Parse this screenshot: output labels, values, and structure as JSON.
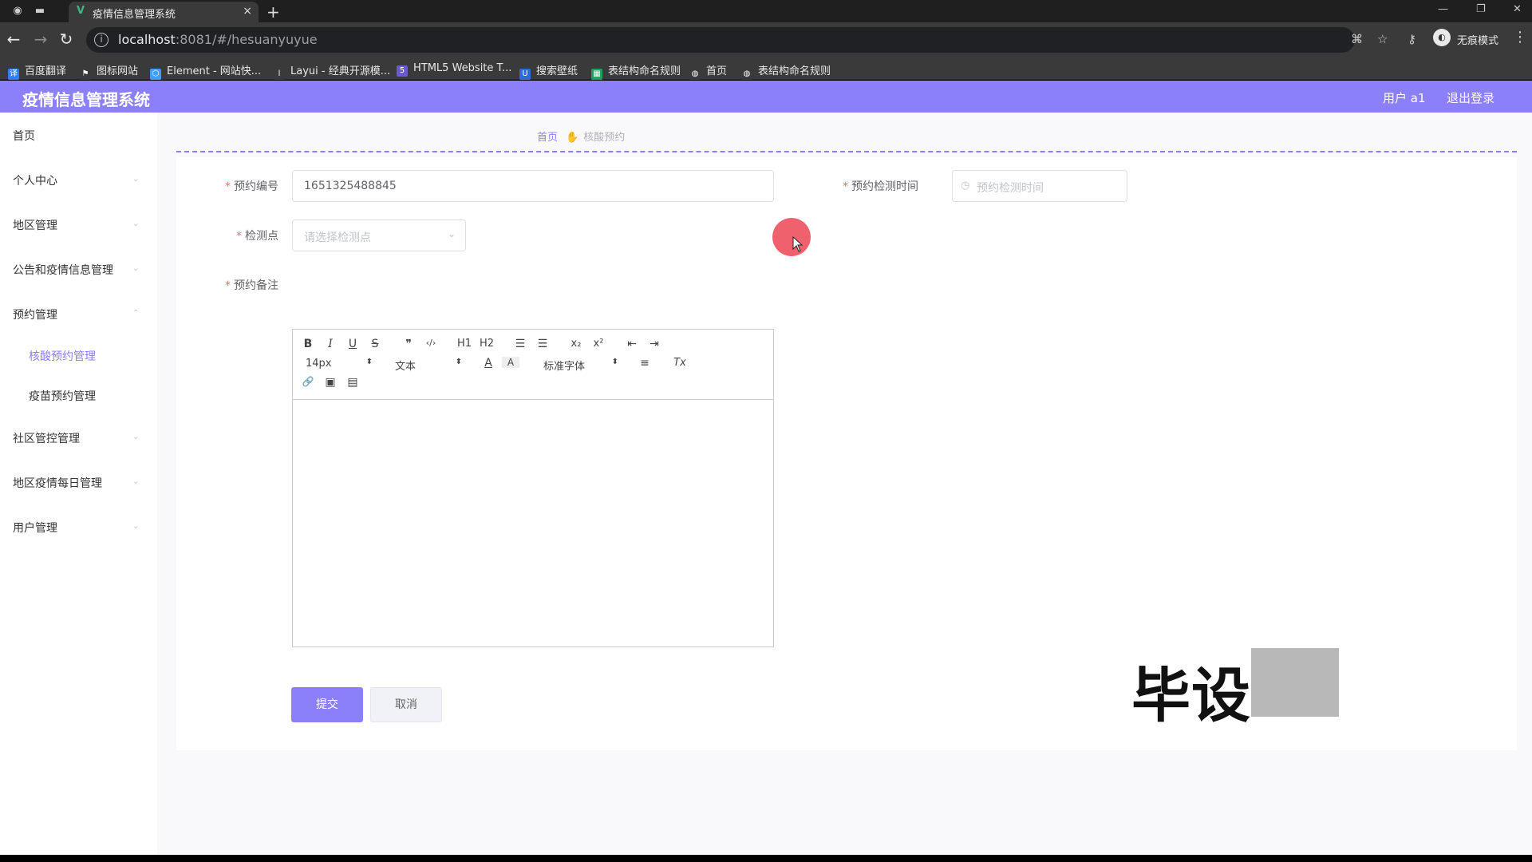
{
  "browser": {
    "tab_title": "疫情信息管理系统",
    "tab_close": "×",
    "new_tab": "+",
    "url_host": "localhost",
    "url_path": ":8081/#/hesuanyuyue",
    "incognito_label": "无痕模式",
    "bookmarks": [
      {
        "label": "百度翻译",
        "icon": "baidu-translate-icon",
        "color": "#2d7ff9"
      },
      {
        "label": "图标网站",
        "icon": "flag-icon",
        "color": "#3a3a3a"
      },
      {
        "label": "Element - 网站快...",
        "icon": "element-icon",
        "color": "#409eff"
      },
      {
        "label": "Layui - 经典开源模...",
        "icon": "layui-icon",
        "color": "#3a3a3a"
      },
      {
        "label": "HTML5 Website T...",
        "icon": "html5-icon",
        "color": "#6a5acd"
      },
      {
        "label": "搜索壁纸",
        "icon": "wallpaper-icon",
        "color": "#2d6cdf"
      },
      {
        "label": "表结构命名规则",
        "icon": "sheet-icon",
        "color": "#1aa260"
      },
      {
        "label": "首页",
        "icon": "globe-icon",
        "color": "#3a3a3a"
      },
      {
        "label": "表结构命名规则",
        "icon": "globe-icon",
        "color": "#3a3a3a"
      }
    ]
  },
  "app": {
    "brand": "疫情信息管理系统",
    "user_label": "用户 a1",
    "logout_label": "退出登录",
    "accent_color": "#8b80f9"
  },
  "sidebar": {
    "items": [
      {
        "label": "首页"
      },
      {
        "label": "个人中心"
      },
      {
        "label": "地区管理"
      },
      {
        "label": "公告和疫情信息管理"
      },
      {
        "label": "预约管理"
      },
      {
        "label": "社区管控管理"
      },
      {
        "label": "地区疫情每日管理"
      },
      {
        "label": "用户管理"
      }
    ],
    "subitems": [
      {
        "label": "核酸预约管理",
        "active": true
      },
      {
        "label": "疫苗预约管理",
        "active": false
      }
    ]
  },
  "breadcrumb": {
    "home": "首页",
    "current": "核酸预约"
  },
  "form": {
    "booking_no_label": "预约编号",
    "booking_no_value": "1651325488845",
    "test_time_label": "预约检测时间",
    "test_time_placeholder": "预约检测时间",
    "test_site_label": "检测点",
    "test_site_placeholder": "请选择检测点",
    "remark_label": "预约备注",
    "required_mark": "*"
  },
  "editor": {
    "font_size": "14px",
    "block_format": "文本",
    "font_family": "标准字体",
    "buttons": {
      "bold": "B",
      "italic": "I",
      "underline": "U",
      "strike": "S",
      "quote": "❞",
      "code": "‹/›",
      "h1": "H1",
      "h2": "H2",
      "ol": "☰",
      "ul": "☰",
      "sub": "x₂",
      "sup": "x²",
      "outdent": "⇤",
      "indent": "⇥",
      "color": "A",
      "bg": "A",
      "align": "≡",
      "clean": "Tx",
      "link": "🔗",
      "image": "▣",
      "video": "▤"
    }
  },
  "actions": {
    "submit": "提交",
    "cancel": "取消"
  },
  "overlay": {
    "watermark_visible": "毕设"
  }
}
